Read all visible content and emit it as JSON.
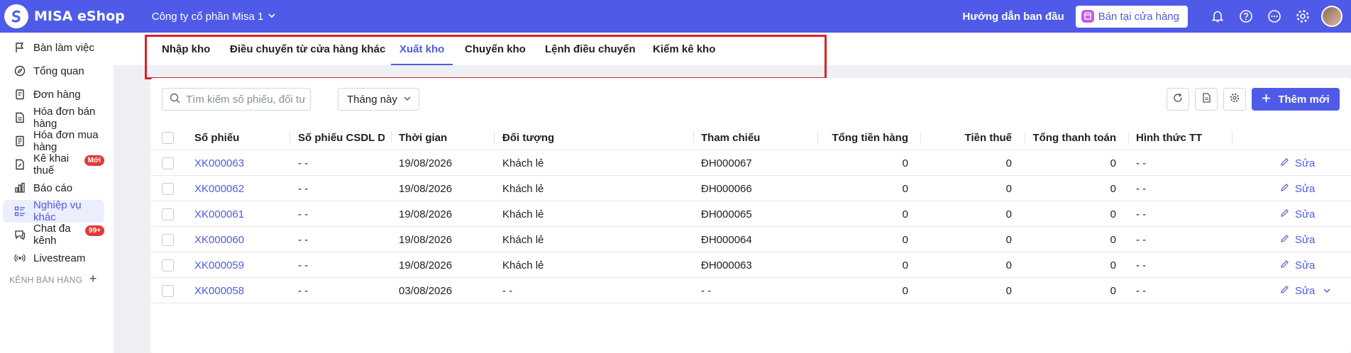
{
  "header": {
    "app_title": "MISA eShop",
    "company": "Công ty cổ phần Misa 1",
    "guide": "Hướng dẫn ban đầu",
    "shop_button": "Bán tại cửa hàng",
    "icons": [
      "bell-icon",
      "help-icon",
      "more-icon",
      "gear-icon"
    ],
    "accent": "#4f5be8"
  },
  "sidebar": {
    "items": [
      {
        "label": "Bàn làm việc",
        "icon": "flag-icon"
      },
      {
        "label": "Tổng quan",
        "icon": "compass-icon"
      },
      {
        "label": "Đơn hàng",
        "icon": "order-icon"
      },
      {
        "label": "Hóa đơn bán hàng",
        "icon": "invoice-icon"
      },
      {
        "label": "Hóa đơn mua hàng",
        "icon": "purchase-icon"
      },
      {
        "label": "Kê khai thuế",
        "icon": "tax-icon",
        "badge": "Mới"
      },
      {
        "label": "Báo cáo",
        "icon": "chart-icon"
      },
      {
        "label": "Nghiệp vụ khác",
        "icon": "list-icon",
        "active": true
      },
      {
        "label": "Chat đa kênh",
        "icon": "chat-icon",
        "badge": "99+"
      },
      {
        "label": "Livestream",
        "icon": "live-icon"
      }
    ],
    "section_title": "KÊNH BÁN HÀNG",
    "section_add": "+"
  },
  "tabs": [
    {
      "label": "Nhập kho"
    },
    {
      "label": "Điều chuyển từ cửa hàng khác"
    },
    {
      "label": "Xuất kho",
      "active": true
    },
    {
      "label": "Chuyển kho"
    },
    {
      "label": "Lệnh điều chuyển"
    },
    {
      "label": "Kiểm kê kho"
    }
  ],
  "toolbar": {
    "search_placeholder": "Tìm kiếm số phiếu, đối tượng",
    "period": "Tháng này",
    "add_label": "Thêm mới"
  },
  "table": {
    "columns": [
      "Số phiếu",
      "Số phiếu CSDL Dược",
      "Thời gian",
      "Đối tượng",
      "Tham chiếu",
      "Tổng tiền hàng",
      "Tiền thuế",
      "Tổng thanh toán",
      "Hình thức TT"
    ],
    "edit_label": "Sửa",
    "rows": [
      {
        "code": "XK000063",
        "csdl": "- -",
        "date": "19/08/2026",
        "party": "Khách lẻ",
        "ref": "ĐH000067",
        "total": "0",
        "tax": "0",
        "pay": "0",
        "method": "- -"
      },
      {
        "code": "XK000062",
        "csdl": "- -",
        "date": "19/08/2026",
        "party": "Khách lẻ",
        "ref": "ĐH000066",
        "total": "0",
        "tax": "0",
        "pay": "0",
        "method": "- -"
      },
      {
        "code": "XK000061",
        "csdl": "- -",
        "date": "19/08/2026",
        "party": "Khách lẻ",
        "ref": "ĐH000065",
        "total": "0",
        "tax": "0",
        "pay": "0",
        "method": "- -"
      },
      {
        "code": "XK000060",
        "csdl": "- -",
        "date": "19/08/2026",
        "party": "Khách lẻ",
        "ref": "ĐH000064",
        "total": "0",
        "tax": "0",
        "pay": "0",
        "method": "- -"
      },
      {
        "code": "XK000059",
        "csdl": "- -",
        "date": "19/08/2026",
        "party": "Khách lẻ",
        "ref": "ĐH000063",
        "total": "0",
        "tax": "0",
        "pay": "0",
        "method": "- -"
      },
      {
        "code": "XK000058",
        "csdl": "- -",
        "date": "03/08/2026",
        "party": "- -",
        "ref": "- -",
        "total": "0",
        "tax": "0",
        "pay": "0",
        "method": "- -",
        "expand": true
      }
    ]
  }
}
